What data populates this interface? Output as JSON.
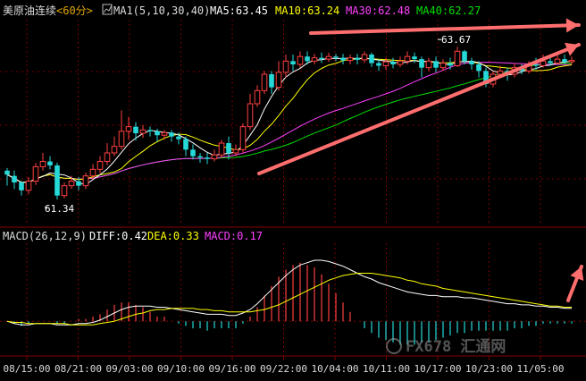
{
  "header": {
    "symbol": "美原油连续",
    "period": "<60分>",
    "ma_label": "MA1(5,10,30,40)",
    "ma5": "MA5:63.45",
    "ma10": "MA10:63.24",
    "ma30": "MA30:62.48",
    "ma40": "MA40:62.27"
  },
  "macd_header": {
    "label": "MACD(26,12,9)",
    "diff": "DIFF:0.42",
    "dea": "DEA:0.33",
    "macd": "MACD:0.17"
  },
  "colors": {
    "up": "#ff4040",
    "down": "#26d9d9",
    "ma5": "#ffffff",
    "ma10": "#ffff00",
    "ma30": "#ff40ff",
    "ma40": "#00e000",
    "diff": "#ffffff",
    "dea": "#ffff00",
    "grid": "#7a0000",
    "axis_text": "#dcdcdc",
    "annotation": "#ff6e6e"
  },
  "watermark": "FX678 汇通网",
  "chart_data": [
    {
      "type": "candlestick",
      "title": "美原油连续<60分>",
      "ylim": [
        61.0,
        64.0
      ],
      "x_labels": [
        "08/15:00",
        "08/21:00",
        "09/03:00",
        "09/10:00",
        "09/16:00",
        "09/22:00",
        "10/04:00",
        "10/11:00",
        "10/17:00",
        "10/23:00",
        "11/05:00"
      ],
      "annotations": [
        {
          "text": "61.34",
          "type": "low",
          "price": 61.34,
          "candle_index": 6
        },
        {
          "text": "63.67",
          "type": "high",
          "price": 63.67,
          "candle_index": 63
        }
      ],
      "candles": [
        [
          61.78,
          61.72,
          61.82,
          61.55
        ],
        [
          61.7,
          61.6,
          61.78,
          61.5
        ],
        [
          61.6,
          61.48,
          61.62,
          61.4
        ],
        [
          61.48,
          61.62,
          61.68,
          61.42
        ],
        [
          61.62,
          61.84,
          61.9,
          61.56
        ],
        [
          61.84,
          61.92,
          62.05,
          61.78
        ],
        [
          61.92,
          61.86,
          62.0,
          61.8
        ],
        [
          61.86,
          61.4,
          61.9,
          61.34
        ],
        [
          61.4,
          61.55,
          61.6,
          61.36
        ],
        [
          61.55,
          61.62,
          61.7,
          61.5
        ],
        [
          61.62,
          61.55,
          61.68,
          61.48
        ],
        [
          61.55,
          61.7,
          61.75,
          61.5
        ],
        [
          61.7,
          61.8,
          61.88,
          61.65
        ],
        [
          61.8,
          61.92,
          62.0,
          61.74
        ],
        [
          61.92,
          62.05,
          62.2,
          61.86
        ],
        [
          62.05,
          62.15,
          62.3,
          62.0
        ],
        [
          62.15,
          62.38,
          62.7,
          62.1
        ],
        [
          62.38,
          62.45,
          62.6,
          62.25
        ],
        [
          62.45,
          62.35,
          62.52,
          62.24
        ],
        [
          62.35,
          62.4,
          62.48,
          62.28
        ],
        [
          62.4,
          62.38,
          62.45,
          62.3
        ],
        [
          62.38,
          62.32,
          62.42,
          62.22
        ],
        [
          62.32,
          62.36,
          62.4,
          62.25
        ],
        [
          62.36,
          62.3,
          62.4,
          62.22
        ],
        [
          62.3,
          62.26,
          62.36,
          62.18
        ],
        [
          62.26,
          62.1,
          62.3,
          62.0
        ],
        [
          62.1,
          62.0,
          62.18,
          61.95
        ],
        [
          62.0,
          61.98,
          62.05,
          61.9
        ],
        [
          61.98,
          61.96,
          62.05,
          61.88
        ],
        [
          61.96,
          62.02,
          62.1,
          61.92
        ],
        [
          62.02,
          62.2,
          62.25,
          61.98
        ],
        [
          62.2,
          62.05,
          62.3,
          61.95
        ],
        [
          62.05,
          62.1,
          62.18,
          62.0
        ],
        [
          62.1,
          62.45,
          62.5,
          62.05
        ],
        [
          62.45,
          62.8,
          62.95,
          62.4
        ],
        [
          62.8,
          63.0,
          63.08,
          62.75
        ],
        [
          63.0,
          63.25,
          63.3,
          62.95
        ],
        [
          63.25,
          63.05,
          63.3,
          62.95
        ],
        [
          63.05,
          63.28,
          63.45,
          63.0
        ],
        [
          63.28,
          63.45,
          63.55,
          63.2
        ],
        [
          63.45,
          63.4,
          63.55,
          63.3
        ],
        [
          63.4,
          63.52,
          63.6,
          63.35
        ],
        [
          63.52,
          63.45,
          63.6,
          63.4
        ],
        [
          63.45,
          63.5,
          63.56,
          63.4
        ],
        [
          63.5,
          63.48,
          63.58,
          63.42
        ],
        [
          63.48,
          63.52,
          63.58,
          63.44
        ],
        [
          63.52,
          63.5,
          63.56,
          63.45
        ],
        [
          63.5,
          63.46,
          63.56,
          63.4
        ],
        [
          63.46,
          63.5,
          63.55,
          63.4
        ],
        [
          63.5,
          63.47,
          63.56,
          63.4
        ],
        [
          63.47,
          63.55,
          63.6,
          63.42
        ],
        [
          63.55,
          63.42,
          63.58,
          63.36
        ],
        [
          63.42,
          63.38,
          63.48,
          63.3
        ],
        [
          63.38,
          63.44,
          63.5,
          63.32
        ],
        [
          63.44,
          63.4,
          63.5,
          63.34
        ],
        [
          63.4,
          63.45,
          63.52,
          63.36
        ],
        [
          63.45,
          63.52,
          63.6,
          63.4
        ],
        [
          63.52,
          63.48,
          63.58,
          63.42
        ],
        [
          63.48,
          63.35,
          63.52,
          63.2
        ],
        [
          63.35,
          63.45,
          63.5,
          63.3
        ],
        [
          63.45,
          63.35,
          63.52,
          63.28
        ],
        [
          63.35,
          63.42,
          63.48,
          63.3
        ],
        [
          63.42,
          63.38,
          63.5,
          63.32
        ],
        [
          63.38,
          63.6,
          63.67,
          63.36
        ],
        [
          63.6,
          63.45,
          63.62,
          63.4
        ],
        [
          63.45,
          63.4,
          63.5,
          63.32
        ],
        [
          63.4,
          63.3,
          63.45,
          63.2
        ],
        [
          63.3,
          63.1,
          63.35,
          63.05
        ],
        [
          63.1,
          63.25,
          63.3,
          63.05
        ],
        [
          63.25,
          63.3,
          63.38,
          63.2
        ],
        [
          63.3,
          63.25,
          63.35,
          63.15
        ],
        [
          63.25,
          63.35,
          63.42,
          63.2
        ],
        [
          63.35,
          63.3,
          63.4,
          63.25
        ],
        [
          63.3,
          63.4,
          63.45,
          63.26
        ],
        [
          63.4,
          63.38,
          63.5,
          63.32
        ],
        [
          63.38,
          63.45,
          63.55,
          63.35
        ],
        [
          63.45,
          63.42,
          63.52,
          63.38
        ],
        [
          63.42,
          63.48,
          63.55,
          63.4
        ],
        [
          63.48,
          63.44,
          63.55,
          63.4
        ],
        [
          63.44,
          63.46,
          63.52,
          63.4
        ]
      ]
    },
    {
      "type": "bar+line",
      "title": "MACD(26,12,9)",
      "ylim": [
        -0.25,
        0.65
      ],
      "series_names": [
        "DIFF",
        "DEA",
        "MACD"
      ],
      "diff": [
        0.0,
        -0.02,
        -0.03,
        -0.03,
        -0.02,
        -0.02,
        -0.02,
        -0.03,
        -0.03,
        -0.03,
        -0.02,
        -0.02,
        -0.01,
        0.01,
        0.04,
        0.07,
        0.1,
        0.12,
        0.13,
        0.13,
        0.13,
        0.12,
        0.12,
        0.11,
        0.1,
        0.09,
        0.08,
        0.07,
        0.06,
        0.06,
        0.06,
        0.05,
        0.05,
        0.07,
        0.1,
        0.15,
        0.21,
        0.27,
        0.33,
        0.39,
        0.44,
        0.48,
        0.5,
        0.52,
        0.52,
        0.51,
        0.49,
        0.47,
        0.44,
        0.41,
        0.38,
        0.36,
        0.33,
        0.31,
        0.29,
        0.27,
        0.25,
        0.24,
        0.23,
        0.22,
        0.22,
        0.21,
        0.21,
        0.21,
        0.2,
        0.2,
        0.19,
        0.18,
        0.17,
        0.16,
        0.15,
        0.15,
        0.14,
        0.14,
        0.13,
        0.13,
        0.12,
        0.12,
        0.11,
        0.11
      ],
      "dea": [
        0.0,
        -0.01,
        -0.01,
        -0.02,
        -0.02,
        -0.02,
        -0.02,
        -0.02,
        -0.02,
        -0.03,
        -0.03,
        -0.03,
        -0.03,
        -0.02,
        -0.01,
        0.0,
        0.02,
        0.04,
        0.06,
        0.07,
        0.09,
        0.1,
        0.1,
        0.11,
        0.11,
        0.11,
        0.11,
        0.1,
        0.1,
        0.09,
        0.09,
        0.08,
        0.08,
        0.08,
        0.08,
        0.09,
        0.1,
        0.12,
        0.14,
        0.17,
        0.2,
        0.23,
        0.26,
        0.29,
        0.32,
        0.35,
        0.37,
        0.39,
        0.4,
        0.41,
        0.41,
        0.41,
        0.4,
        0.39,
        0.38,
        0.37,
        0.35,
        0.34,
        0.32,
        0.31,
        0.3,
        0.28,
        0.27,
        0.26,
        0.25,
        0.24,
        0.23,
        0.22,
        0.21,
        0.2,
        0.19,
        0.18,
        0.17,
        0.16,
        0.15,
        0.14,
        0.13,
        0.13,
        0.12,
        0.12
      ],
      "note": "MACD histogram bars = 2*(DIFF-DEA); red when positive, cyan when negative"
    }
  ]
}
